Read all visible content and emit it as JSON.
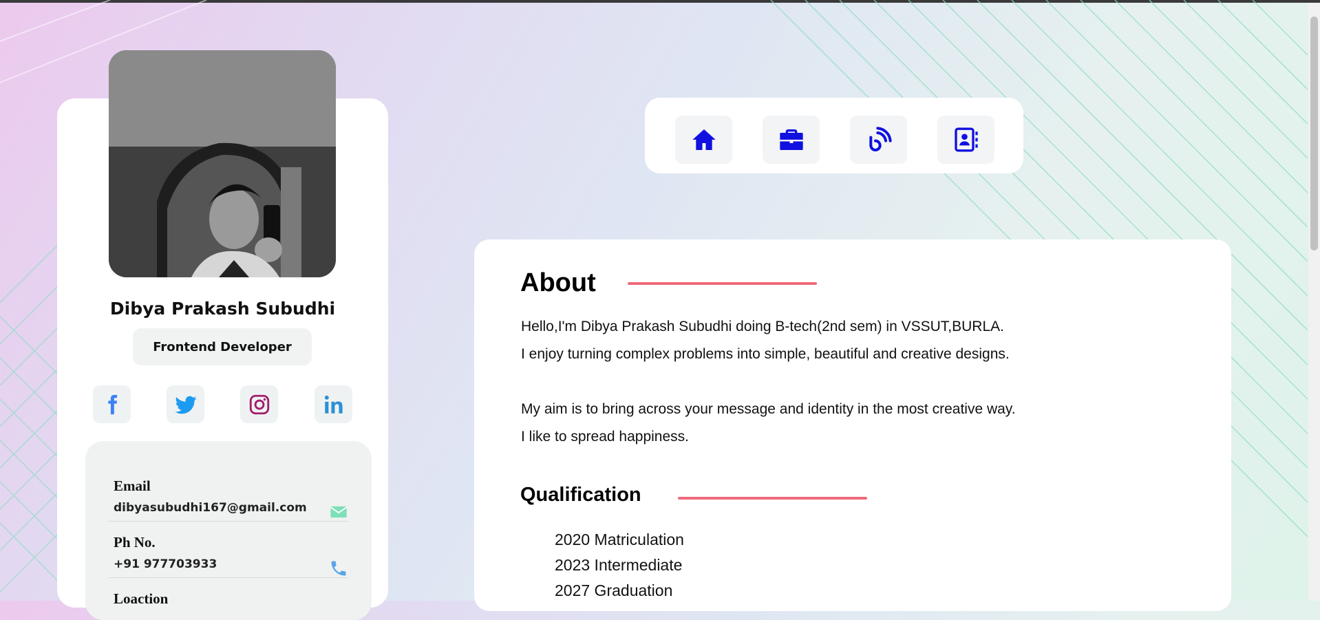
{
  "profile": {
    "name": "Dibya Prakash Subudhi",
    "role": "Frontend Developer",
    "socials": [
      {
        "name": "Facebook",
        "icon": "facebook-icon",
        "color": "#3b82f6"
      },
      {
        "name": "Twitter",
        "icon": "twitter-icon",
        "color": "#1d9bf0"
      },
      {
        "name": "Instagram",
        "icon": "instagram-icon",
        "color": "#a21c6a"
      },
      {
        "name": "LinkedIn",
        "icon": "linkedin-icon",
        "color": "#2c8fd6"
      }
    ],
    "contacts": {
      "email_label": "Email",
      "email_value": "dibyasubudhi167@gmail.com",
      "phone_label": "Ph No.",
      "phone_value": "+91 977703933",
      "location_label": "Loaction"
    }
  },
  "nav": {
    "items": [
      {
        "name": "home",
        "icon": "home-icon"
      },
      {
        "name": "work",
        "icon": "briefcase-icon"
      },
      {
        "name": "blog",
        "icon": "blog-icon"
      },
      {
        "name": "contact",
        "icon": "contact-book-icon"
      }
    ],
    "icon_color": "#1010e0"
  },
  "about": {
    "title": "About",
    "lines": [
      "Hello,I'm Dibya Prakash Subudhi doing B-tech(2nd sem) in VSSUT,BURLA.",
      "I enjoy turning complex problems into simple, beautiful and creative designs.",
      "My aim is to bring across your message and identity in the most creative way.",
      "I like to spread happiness."
    ]
  },
  "qualification": {
    "title": "Qualification",
    "items": [
      "2020 Matriculation",
      "2023 Intermediate",
      "2027 Graduation"
    ]
  },
  "colors": {
    "accent": "#ef6a7a",
    "nav_icon": "#1010e0",
    "email_icon": "#7ee0b8",
    "phone_icon": "#5aa6e6"
  }
}
